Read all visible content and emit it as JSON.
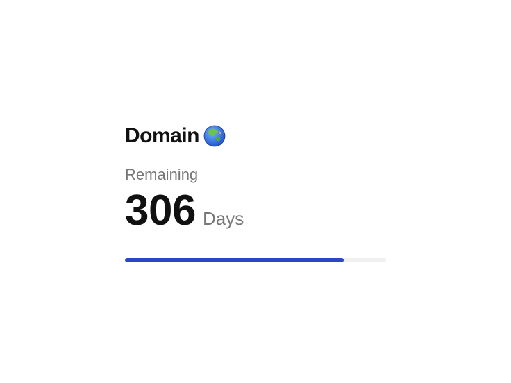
{
  "card": {
    "title": "Domain",
    "title_icon": "globe-asia-icon",
    "remaining_label": "Remaining",
    "value": "306",
    "unit": "Days",
    "progress_fraction": 0.838,
    "colors": {
      "accent": "#2b47c8",
      "track": "#f0f0f0",
      "muted_text": "#777777",
      "primary_text": "#111111"
    }
  }
}
